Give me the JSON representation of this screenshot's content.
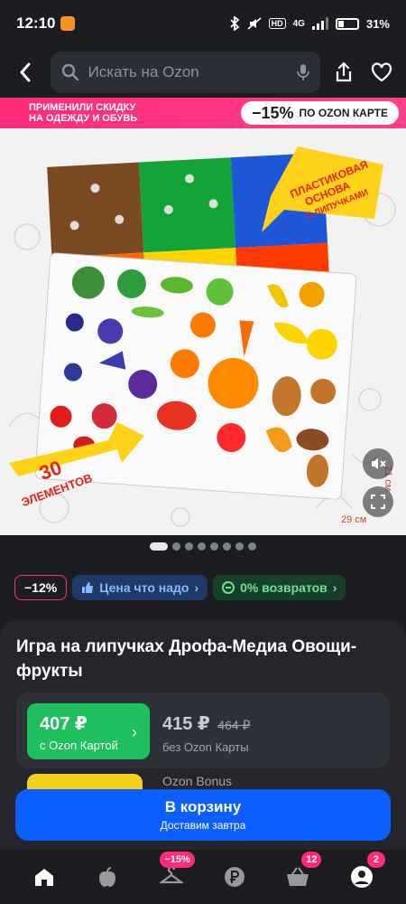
{
  "status": {
    "time": "12:10",
    "network": "4G",
    "battery": "31%"
  },
  "search": {
    "placeholder": "Искать на Ozon"
  },
  "banner": {
    "line1": "ПРИМЕНИЛИ СКИДКУ",
    "line2": "НА ОДЕЖДУ И ОБУВЬ",
    "discount": "−15%",
    "discount_text": "ПО OZON КАРТЕ"
  },
  "image": {
    "callout_top_1": "ПЛАСТИКОВАЯ",
    "callout_top_2": "ОСНОВА",
    "callout_top_3": "С ЛИПУЧКАМИ",
    "callout_bottom_1": "30",
    "callout_bottom_2": "ЭЛЕМЕНТОВ",
    "dim_width": "29 см",
    "dim_height": "21 см"
  },
  "carousel": {
    "count": 8,
    "active": 0
  },
  "chips": {
    "discount": "−12%",
    "value_price": "Цена что надо",
    "returns": "0% возвратов"
  },
  "product": {
    "title": "Игра на липучках Дрофа-Медиа Овощи-фрукты"
  },
  "price": {
    "ozon_card_price": "407 ₽",
    "ozon_card_label": "с Ozon Картой",
    "price": "415 ₽",
    "old_price": "464 ₽",
    "no_card_label": "без Ozon Карты",
    "peek_text": "Ozon Bonus"
  },
  "cta": {
    "label": "В корзину",
    "sublabel": "Доставим завтра"
  },
  "nav": {
    "promo_badge": "−15%",
    "cart_badge": "12",
    "profile_badge": "2"
  },
  "colors": {
    "accent_pink": "#ff2b7a",
    "ozon_blue": "#0b5fff",
    "green": "#1ec05d"
  }
}
